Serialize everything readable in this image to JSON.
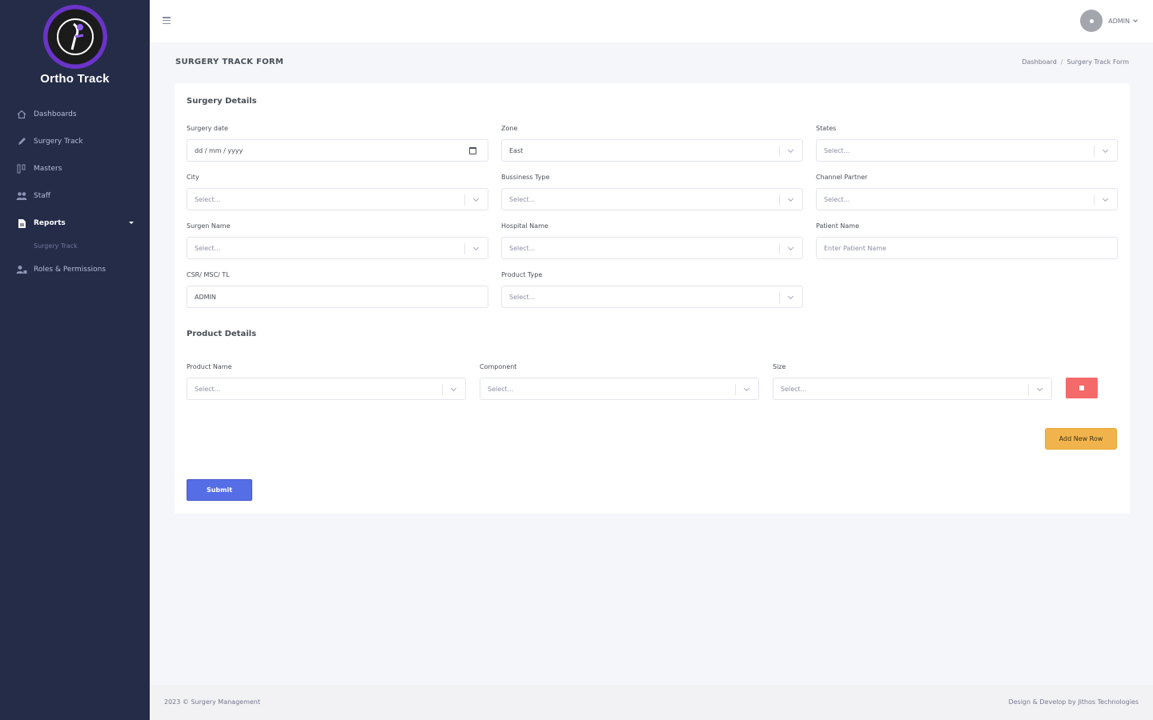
{
  "brand": {
    "name": "Ortho Track"
  },
  "sidebar": {
    "items": [
      {
        "label": "Dashboards",
        "icon": "home-icon"
      },
      {
        "label": "Surgery Track",
        "icon": "pen-icon"
      },
      {
        "label": "Masters",
        "icon": "grid-icon"
      },
      {
        "label": "Staff",
        "icon": "users-icon"
      },
      {
        "label": "Reports",
        "icon": "file-icon",
        "active": true
      },
      {
        "label": "Roles & Permissions",
        "icon": "user-lock-icon"
      }
    ],
    "submenu": {
      "label": "Surgery Track"
    }
  },
  "header": {
    "user_name": "ADMIN",
    "avatar_initial": ""
  },
  "page": {
    "title": "SURGERY TRACK FORM",
    "breadcrumb": [
      "Dashboard",
      "Surgery Track Form"
    ]
  },
  "form": {
    "surgery_section_title": "Surgery Details",
    "fields": {
      "surgery_date": {
        "label": "Surgery date",
        "value": "dd / mm / yyyy"
      },
      "zone": {
        "label": "Zone",
        "value": "East"
      },
      "states": {
        "label": "States",
        "value": "Select..."
      },
      "city": {
        "label": "City",
        "value": "Select..."
      },
      "business_type": {
        "label": "Bussiness Type",
        "value": "Select..."
      },
      "channel_partner": {
        "label": "Channel Partner",
        "value": "Select..."
      },
      "surgen_name": {
        "label": "Surgen Name",
        "value": "Select..."
      },
      "hospital_name": {
        "label": "Hospital Name",
        "value": "Select..."
      },
      "patient_name": {
        "label": "Patient Name",
        "placeholder": "Enter Patient Name"
      },
      "csr": {
        "label": "CSR/ MSC/ TL",
        "value": "ADMIN"
      },
      "product_type": {
        "label": "Product Type",
        "value": "Select..."
      }
    },
    "product_section_title": "Product Details",
    "product_fields": {
      "product_name": {
        "label": "Product Name",
        "value": "Select..."
      },
      "component": {
        "label": "Component",
        "value": "Select..."
      },
      "size": {
        "label": "Size",
        "value": "Select..."
      }
    },
    "add_row_label": "Add New Row",
    "submit_label": "Submit"
  },
  "footer": {
    "left": "2023 © Surgery Management",
    "right": "Design & Develop by Jithos Technologies"
  },
  "colors": {
    "sidebar_bg": "#252c48",
    "primary": "#556ee6",
    "warning": "#f1b44c",
    "danger": "#f46a6a"
  }
}
